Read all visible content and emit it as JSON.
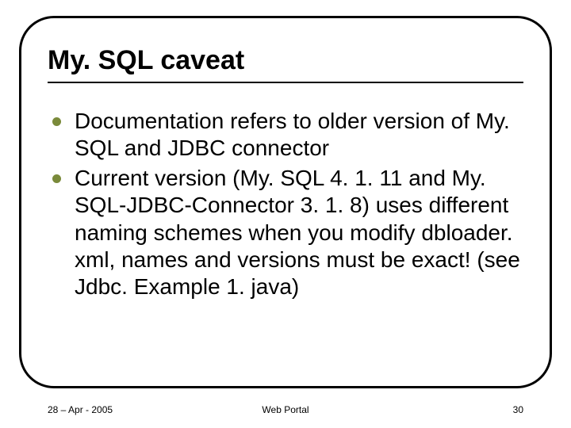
{
  "slide": {
    "title": "My. SQL caveat",
    "bullets": [
      "Documentation refers to older version of My. SQL and JDBC connector",
      "Current version (My. SQL 4. 1. 11 and My. SQL-JDBC-Connector 3. 1. 8) uses different naming schemes when you modify dbloader. xml, names and versions must be exact! (see Jdbc. Example 1. java)"
    ]
  },
  "footer": {
    "date": "28 – Apr - 2005",
    "center": "Web Portal",
    "page": "30"
  },
  "colors": {
    "bullet": "#7a8a3a"
  }
}
